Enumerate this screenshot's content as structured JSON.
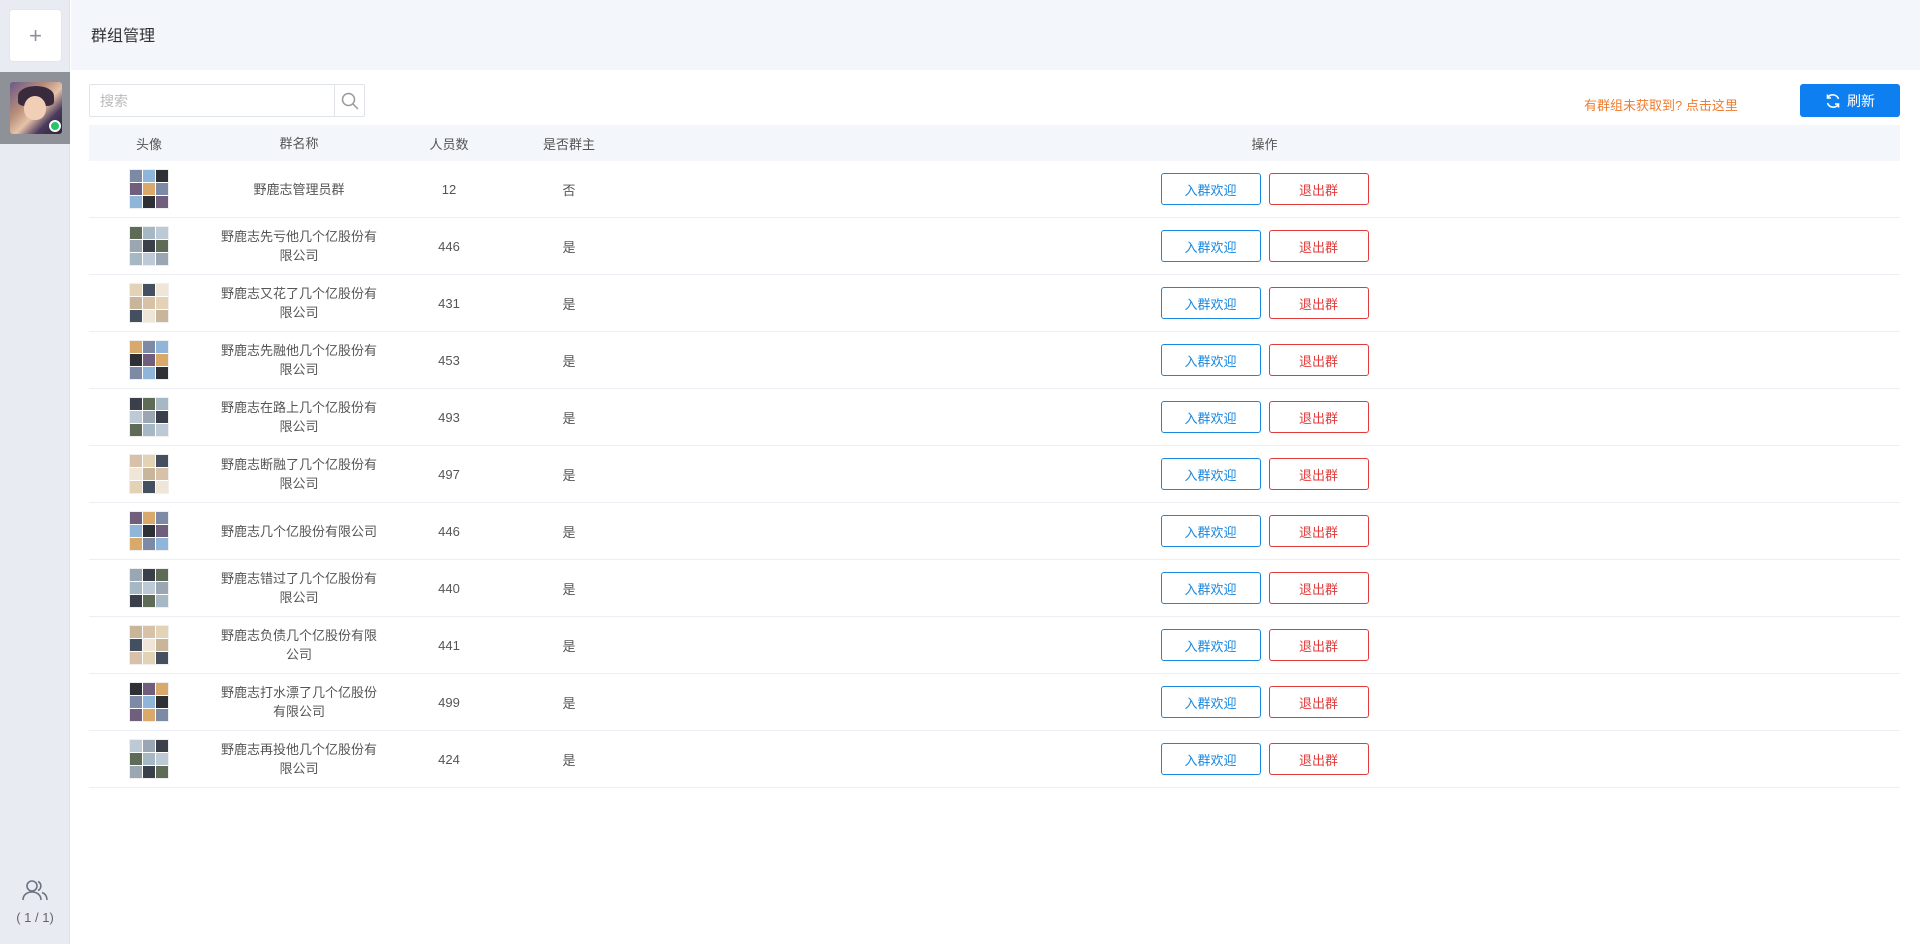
{
  "sidebar": {
    "add_label": "+",
    "page_count": "( 1 / 1)"
  },
  "header": {
    "title": "群组管理"
  },
  "toolbar": {
    "search_placeholder": "搜索",
    "hint_text": "有群组未获取到? 点击这里",
    "refresh_label": "刷新"
  },
  "table": {
    "headers": {
      "avatar": "头像",
      "name": "群名称",
      "count": "人员数",
      "owner": "是否群主",
      "ops": "操作"
    },
    "welcome_label": "入群欢迎",
    "quit_label": "退出群",
    "rows": [
      {
        "name": "野鹿志管理员群",
        "count": "12",
        "owner": "否"
      },
      {
        "name": "野鹿志先亏他几个亿股份有限公司",
        "count": "446",
        "owner": "是"
      },
      {
        "name": "野鹿志又花了几个亿股份有限公司",
        "count": "431",
        "owner": "是"
      },
      {
        "name": "野鹿志先融他几个亿股份有限公司",
        "count": "453",
        "owner": "是"
      },
      {
        "name": "野鹿志在路上几个亿股份有限公司",
        "count": "493",
        "owner": "是"
      },
      {
        "name": "野鹿志断融了几个亿股份有限公司",
        "count": "497",
        "owner": "是"
      },
      {
        "name": "野鹿志几个亿股份有限公司",
        "count": "446",
        "owner": "是"
      },
      {
        "name": "野鹿志错过了几个亿股份有限公司",
        "count": "440",
        "owner": "是"
      },
      {
        "name": "野鹿志负债几个亿股份有限公司",
        "count": "441",
        "owner": "是"
      },
      {
        "name": "野鹿志打水漂了几个亿股份有限公司",
        "count": "499",
        "owner": "是"
      },
      {
        "name": "野鹿志再投他几个亿股份有限公司",
        "count": "424",
        "owner": "是"
      }
    ]
  },
  "colors": {
    "accent": "#0d7ff0",
    "welcome_border": "#1787e0",
    "quit_border": "#e23b3b",
    "hint": "#f07c2e",
    "online": "#27c46b"
  },
  "icons": {
    "add": "plus-icon",
    "search": "search-icon",
    "refresh": "refresh-icon",
    "friends": "friends-icon"
  }
}
